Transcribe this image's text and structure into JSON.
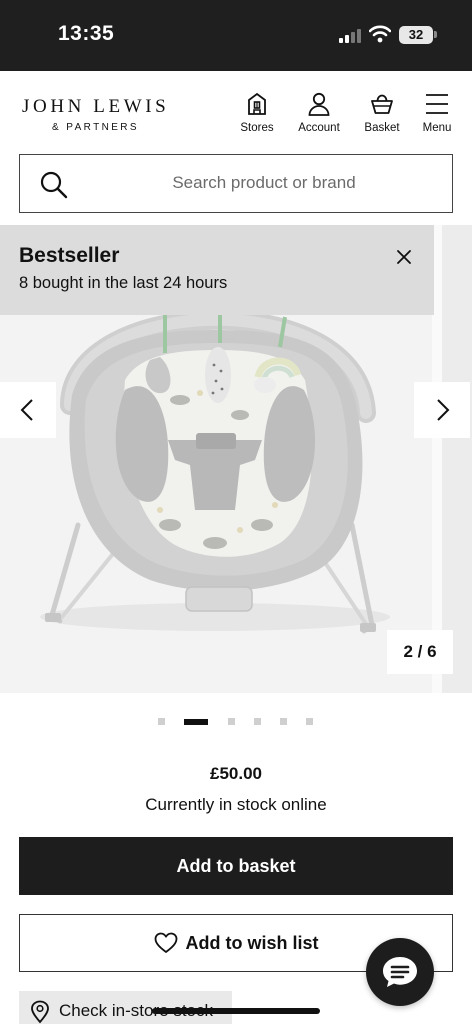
{
  "status_bar": {
    "time": "13:35",
    "battery": "32",
    "icons": [
      "signal-icon",
      "wifi-icon",
      "battery-icon"
    ]
  },
  "header": {
    "logo_main": "JOHN LEWIS",
    "logo_sub": "& PARTNERS",
    "nav": [
      {
        "label": "Stores",
        "icon": "store-icon"
      },
      {
        "label": "Account",
        "icon": "account-icon"
      },
      {
        "label": "Basket",
        "icon": "basket-icon"
      },
      {
        "label": "Menu",
        "icon": "menu-icon"
      }
    ]
  },
  "search": {
    "placeholder": "Search product or brand",
    "value": ""
  },
  "gallery": {
    "badge_title": "Bestseller",
    "badge_text": "8 bought in the last 24 hours",
    "counter": "2 / 6",
    "current_index": 2,
    "total_images": 6,
    "image_subject": "grey baby bouncer with animal-print seat and toy bar"
  },
  "product": {
    "price": "£50.00",
    "stock_status": "Currently in stock online"
  },
  "actions": {
    "add_to_basket": "Add to basket",
    "add_to_wishlist": "Add to wish list",
    "check_stock": "Check in-store stock"
  },
  "colors": {
    "status_bar_bg": "#1f1f1f",
    "primary_button": "#1d1d1d",
    "badge_bg": "#dcdcdc",
    "gallery_bg": "#f2f2f2"
  }
}
